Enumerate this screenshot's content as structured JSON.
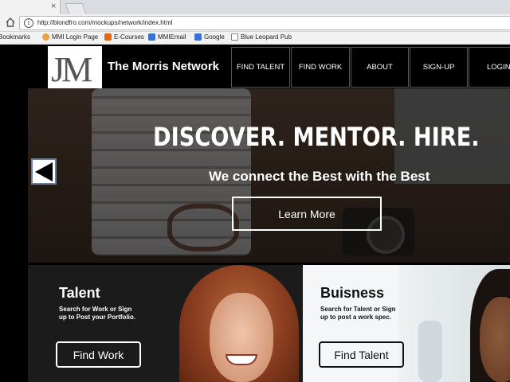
{
  "browser": {
    "tab_close": "×",
    "url": "http://blondfro.com/mockups/network/index.html",
    "bookmarks": [
      {
        "label": "Bookmarks",
        "icon": "bookmarks-icon",
        "color": "#f2f2f2"
      },
      {
        "label": "MMI Login Page",
        "icon": "globe-icon",
        "color": "#e8a33a"
      },
      {
        "label": "E-Courses",
        "icon": "ecourses-icon",
        "color": "#d96b1f"
      },
      {
        "label": "MMIEmail",
        "icon": "mail-icon",
        "color": "#3b6fd4"
      },
      {
        "label": "Google",
        "icon": "google-icon",
        "color": "#3b6fd4"
      },
      {
        "label": "Blue Leopard Pub",
        "icon": "page-icon",
        "color": "#ffffff"
      }
    ]
  },
  "site": {
    "logo_text": "JM",
    "title": "The Morris Network",
    "nav": [
      "FIND TALENT",
      "FIND WORK",
      "ABOUT",
      "SIGN-UP",
      "LOGIN"
    ]
  },
  "hero": {
    "heading": "DISCOVER. MENTOR. HIRE.",
    "subheading": "We connect the Best with the Best",
    "cta_label": "Learn More",
    "prev_icon": "left-arrow-icon"
  },
  "panels": {
    "talent": {
      "heading": "Talent",
      "text_line1": "Search for Work or Sign",
      "text_line2": "up to Post your Portfolio.",
      "button_label": "Find Work"
    },
    "business": {
      "heading": "Buisness",
      "text_line1": "Search for Talent or Sign",
      "text_line2": "up to post a work spec.",
      "button_label": "Find Talent"
    }
  },
  "colors": {
    "nav_bg": "#000000",
    "hero_text": "#ffffff",
    "talent_bg": "#1b1b1b",
    "business_bg": "#f4f6f7"
  }
}
